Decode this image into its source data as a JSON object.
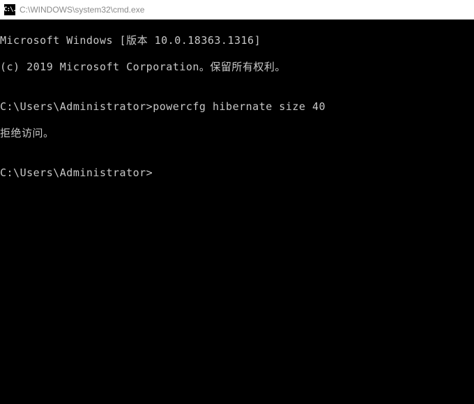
{
  "titleBar": {
    "iconText": "C:\\.",
    "title": "C:\\WINDOWS\\system32\\cmd.exe"
  },
  "terminal": {
    "line1": "Microsoft Windows [版本 10.0.18363.1316]",
    "line2": "(c) 2019 Microsoft Corporation。保留所有权利。",
    "blank1": "",
    "prompt1": "C:\\Users\\Administrator>",
    "command1": "powercfg hibernate size 40",
    "response1": "拒绝访问。",
    "blank2": "",
    "prompt2": "C:\\Users\\Administrator>",
    "command2": ""
  }
}
